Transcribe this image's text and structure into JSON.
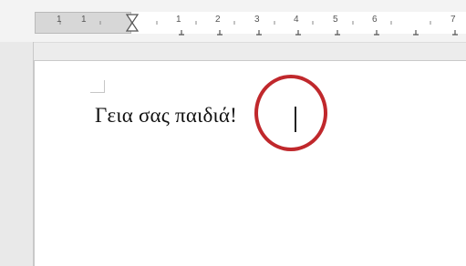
{
  "document": {
    "text": "Γεια σας παιδιά!"
  },
  "ruler": {
    "labels": [
      "1",
      "1",
      "1",
      "2",
      "3",
      "4",
      "5",
      "6",
      "7"
    ]
  },
  "icons": {
    "indent_marker": "hourglass-indent-marker-icon",
    "corner_mark": "text-boundary-corner-icon",
    "highlight": "red-circle-annotation"
  },
  "colors": {
    "annotation": "#c0282c",
    "page": "#ffffff",
    "background": "#ececec"
  }
}
